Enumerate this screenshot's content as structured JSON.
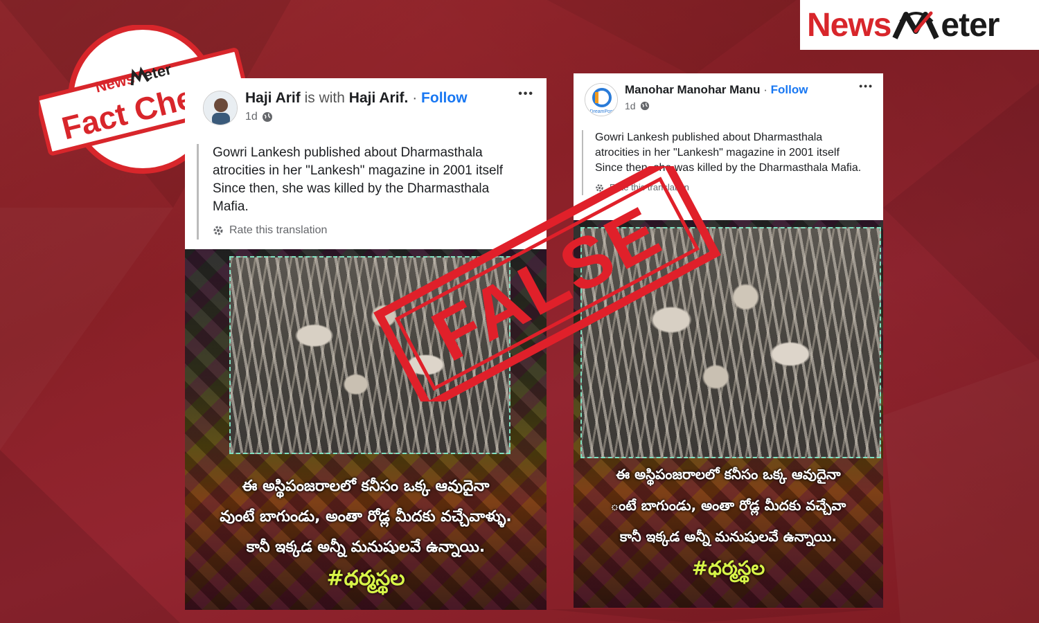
{
  "logo": {
    "news": "News",
    "meter": "eter"
  },
  "badge": {
    "news": "News",
    "meter": "eter",
    "label": "Fact Check"
  },
  "stamp": {
    "label": "FALSE"
  },
  "post1": {
    "author": "Haji Arif",
    "with_text": "is with",
    "with_name": "Haji Arif.",
    "separator": "·",
    "follow": "Follow",
    "time": "1d",
    "more": "•••",
    "caption": "Gowri Lankesh published about Dharmasthala atrocities in her \"Lankesh\" magazine in 2001 itself Since then, she was killed by the Dharmasthala Mafia.",
    "rate": "Rate this translation",
    "telugu_line1": "ఈ అస్థిపంజరాలలో కనీసం ఒక్క ఆవుదైనా",
    "telugu_line2": "వుంటే బాగుండు, అంతా రోడ్ల మీదకు వచ్చేవాళ్ళు.",
    "telugu_line3": "కానీ ఇక్కడ అన్నీ మనుషులవే ఉన్నాయి.",
    "hashtag": "#ధర్మస్థల"
  },
  "post2": {
    "author": "Manohar Manohar Manu",
    "separator": "·",
    "follow": "Follow",
    "time": "1d",
    "more": "•••",
    "avatar_text": "DreamPost",
    "caption": "Gowri Lankesh published about Dharmasthala atrocities in her \"Lankesh\" magazine in 2001 itself Since then, she was killed by the Dharmasthala Mafia.",
    "rate": "Rate this translation",
    "telugu_line1": "ఈ అస్థిపంజరాలలో కనీసం ఒక్క ఆవుదైనా",
    "telugu_line2": "ంటే బాగుండు, అంతా రోడ్ల మీదకు వచ్చేవా",
    "telugu_line3": "కానీ ఇక్కడ అన్నీ మనుషులవే ఉన్నాయి.",
    "hashtag": "#ధర్మస్థల"
  },
  "colors": {
    "background": "#8e2229",
    "brand_red": "#d8262b",
    "follow_blue": "#1877f2",
    "hashtag": "#d8f548"
  }
}
